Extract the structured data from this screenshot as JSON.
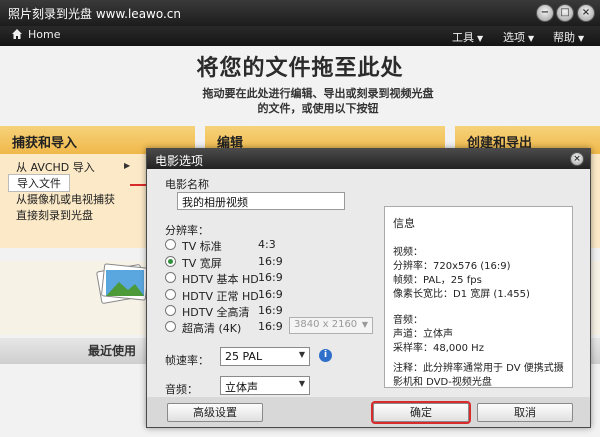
{
  "window": {
    "title": "照片刻录到光盘 www.leawo.cn",
    "controls": {
      "minimize": "−",
      "maximize": "□",
      "close": "×"
    }
  },
  "nav": {
    "home_label": "Home",
    "menus": [
      {
        "label": "工具"
      },
      {
        "label": "选项"
      },
      {
        "label": "帮助"
      }
    ]
  },
  "main": {
    "headline": "将您的文件拖至此处",
    "subline": "拖动要在此处进行编辑、导出或刻录到视频光盘的文件，或使用以下按钮",
    "columns": [
      {
        "title": "捕获和导入"
      },
      {
        "title": "编辑"
      },
      {
        "title": "创建和导出"
      }
    ],
    "capture_items": [
      {
        "label": "从 AVCHD 导入"
      },
      {
        "label": "导入文件"
      },
      {
        "label": "从摄像机或电视捕获"
      },
      {
        "label": "直接刻录到光盘"
      }
    ],
    "recent_title": "最近使用"
  },
  "dialog": {
    "title": "电影选项",
    "close_label": "×",
    "movie_name_label": "电影名称",
    "movie_name_value": "我的相册视频",
    "resolution_label": "分辨率：",
    "resolutions": [
      {
        "name": "TV 标准",
        "ratio": "4:3",
        "selected": false
      },
      {
        "name": "TV 宽屏",
        "ratio": "16:9",
        "selected": true
      },
      {
        "name": "HDTV 基本 HD",
        "ratio": "16:9",
        "selected": false
      },
      {
        "name": "HDTV 正常 HD",
        "ratio": "16:9",
        "selected": false
      },
      {
        "name": "HDTV 全高清",
        "ratio": "16:9",
        "selected": false
      },
      {
        "name": "超高清 (4K)",
        "ratio": "16:9",
        "selected": false
      }
    ],
    "uhd_size": "3840 x 2160",
    "frame_rate_label": "帧速率：",
    "frame_rate_value": "25 PAL",
    "audio_label": "音频：",
    "audio_value": "立体声",
    "info": {
      "heading": "信息",
      "video_label": "视频：",
      "resolution_line": "分辨率：720x576 (16:9)",
      "framerate_line": "帧频：PAL，25 fps",
      "pixel_line": "像素长宽比：D1 宽屏 (1.455)",
      "audio_label": "音频：",
      "channel_line": "声道：立体声",
      "sample_line": "采样率：48,000 Hz",
      "note_line1": "注释：此分辨率通常用于 DV 便携式摄",
      "note_line2": "影机和 DVD-视频光盘"
    },
    "buttons": {
      "advanced": "高级设置",
      "ok": "确定",
      "cancel": "取消"
    }
  }
}
